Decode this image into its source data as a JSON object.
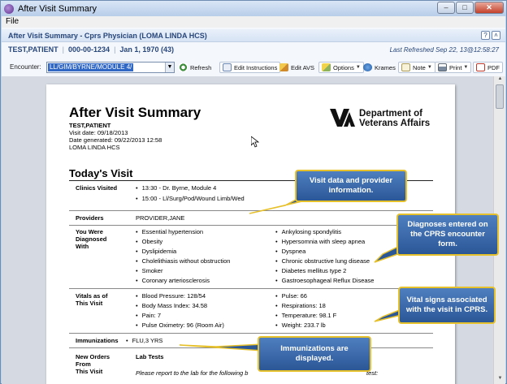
{
  "window": {
    "title": "After Visit Summary",
    "controls": {
      "minimize": "–",
      "restore": "□",
      "close": "✕"
    }
  },
  "menu": {
    "file": "File"
  },
  "header": {
    "title": "After Visit Summary - Cprs Physician (LOMA LINDA HCS)",
    "help_icon": "?",
    "collapse_icon": "˄",
    "patient_name": "TEST,PATIENT",
    "patient_ssn": "000-00-1234",
    "patient_dob": "Jan 1, 1970 (43)",
    "last_refreshed": "Last Refreshed Sep 22, 13@12:58:27"
  },
  "toolbar": {
    "encounter_label": "Encounter:",
    "encounter_value": "LL/GIM/BYRNE/MODULE 4/",
    "refresh": "Refresh",
    "edit_instructions": "Edit Instructions",
    "edit_avs": "Edit AVS",
    "options": "Options",
    "kramers": "Krames",
    "note": "Note",
    "print": "Print",
    "pdf": "PDF"
  },
  "document": {
    "title": "After Visit Summary",
    "patient": "TEST,PATIENT",
    "visit_date": "Visit date: 09/18/2013",
    "date_generated": "Date generated: 09/22/2013 12:58",
    "facility": "LOMA LINDA HCS",
    "logo_line1": "Department of",
    "logo_line2": "Veterans Affairs",
    "todays_visit": "Today's Visit",
    "sections": {
      "clinics_label": "Clinics Visited",
      "clinics": [
        "13:30 - Dr. Byrne, Module 4",
        "15:00 - Ll/Surg/Pod/Wound Limb/Wed"
      ],
      "providers_label": "Providers",
      "providers": "PROVIDER,JANE",
      "diagnosed_label_1": "You Were",
      "diagnosed_label_2": "Diagnosed",
      "diagnosed_label_3": "With",
      "diagnoses_left": [
        "Essential hypertension",
        "Obesity",
        "Dyslipidemia",
        "Cholelithiasis without obstruction",
        "Smoker",
        "Coronary arteriosclerosis"
      ],
      "diagnoses_right": [
        "Ankylosing spondylitis",
        "Hypersomnia with sleep apnea",
        "Dyspnea",
        "Chronic obstructive lung disease",
        "Diabetes mellitus type 2",
        "Gastroesophageal Reflux Disease"
      ],
      "vitals_label_1": "Vitals as of",
      "vitals_label_2": "This Visit",
      "vitals_left": [
        "Blood Pressure: 128/54",
        "Body Mass Index: 34.58",
        "Pain: 7",
        "Pulse Oximetry: 96 (Room Air)"
      ],
      "vitals_right": [
        "Pulse: 66",
        "Respirations: 18",
        "Temperature: 98.1 F",
        "Weight: 233.7 lb"
      ],
      "immunizations_label": "Immunizations",
      "immunizations": "FLU,3 YRS",
      "orders_label_1": "New Orders",
      "orders_label_2": "From",
      "orders_label_3": "This Visit",
      "lab_tests": "Lab Tests",
      "lab_note": "Please report to the lab for the following b",
      "lab_note_end": "test:"
    }
  },
  "callouts": {
    "visit_data": "Visit data and provider information.",
    "diagnoses": "Diagnoses entered on the CPRS encounter form.",
    "vitals": "Vital signs associated with the visit in CPRS.",
    "immunizations": "Immunizations are displayed."
  },
  "colors": {
    "callout_fill": "#3b6aad",
    "callout_border": "#e7c12b",
    "header_text": "#27467a",
    "selection": "#3168c5"
  }
}
